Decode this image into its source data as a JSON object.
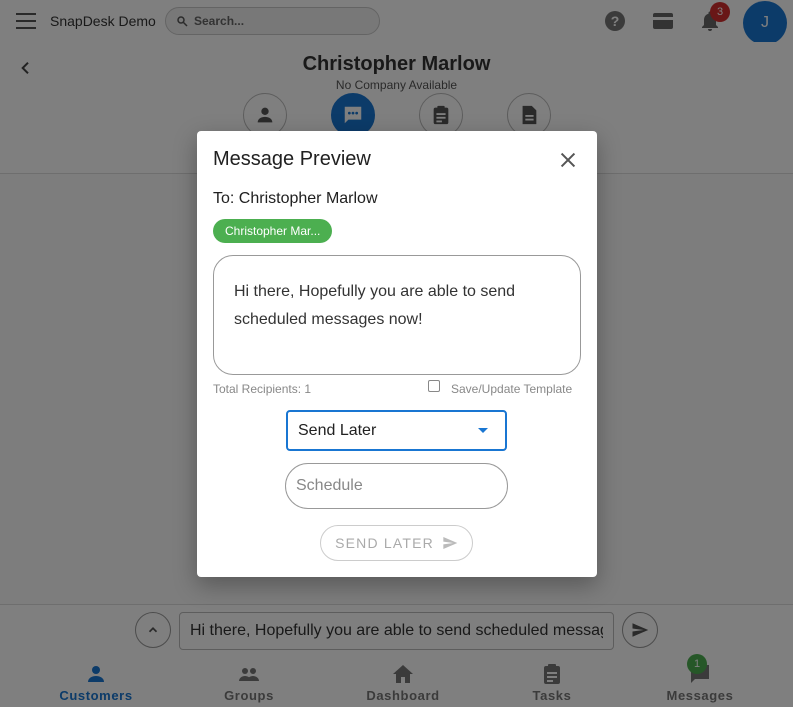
{
  "app": {
    "title": "SnapDesk Demo"
  },
  "search": {
    "placeholder": "Search..."
  },
  "notifications": {
    "count": "3"
  },
  "user": {
    "initial": "J"
  },
  "customer": {
    "name": "Christopher Marlow",
    "company": "No Company Available"
  },
  "message_bar": {
    "value": "Hi there, Hopefully you are able to send scheduled messages now!"
  },
  "nav": {
    "items": [
      {
        "label": "Customers"
      },
      {
        "label": "Groups"
      },
      {
        "label": "Dashboard"
      },
      {
        "label": "Tasks"
      },
      {
        "label": "Messages",
        "badge": "1"
      }
    ]
  },
  "dialog": {
    "title": "Message Preview",
    "to_line": "To: Christopher Marlow",
    "chip_label": "Christopher Mar...",
    "message": "Hi there, Hopefully you are able to send scheduled messages now!",
    "recipients_label": "Total Recipients: 1",
    "template_label": "Save/Update Template",
    "send_mode": "Send Later",
    "schedule_placeholder": "Schedule",
    "send_button": "SEND LATER"
  },
  "colors": {
    "primary": "#1976d2",
    "chip": "#4caf50",
    "badge": "#d32f2f"
  }
}
